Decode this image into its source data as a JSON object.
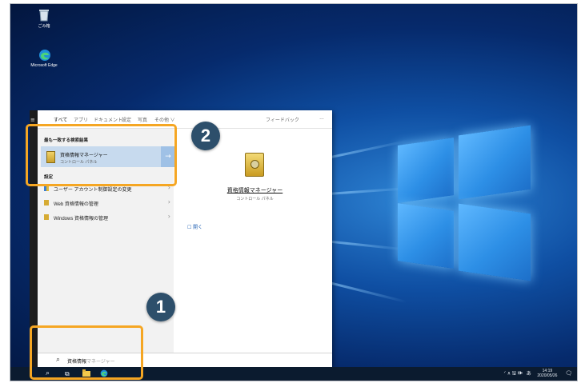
{
  "desktop": {
    "icons": [
      {
        "label": "ごみ箱",
        "icon": "recycle-bin-icon"
      },
      {
        "label": "Microsoft Edge",
        "icon": "edge-icon"
      }
    ]
  },
  "start_menu": {
    "tabs": [
      "すべて",
      "アプリ",
      "ドキュメント",
      "設定",
      "写真",
      "その他 ∨"
    ],
    "feedback": "フィードバック",
    "more": "…",
    "best_match_label": "最も一致する検索結果",
    "best_match": {
      "title": "資格情報マネージャー",
      "subtitle": "コントロール パネル",
      "arrow": "→"
    },
    "settings_label": "設定",
    "settings_items": [
      {
        "label": "ユーザー アカウント制御設定の変更",
        "icon": "flag-icon"
      },
      {
        "label": "Web 資格情報の管理",
        "icon": "credential-icon"
      },
      {
        "label": "Windows 資格情報の管理",
        "icon": "credential-icon"
      }
    ],
    "detail": {
      "title": "資格情報マネージャー",
      "subtitle": "コントロール パネル",
      "open_icon": "☐",
      "open_label": "開く"
    },
    "search": {
      "typed": "資格情報",
      "suggestion": "マネージャー"
    }
  },
  "taskbar": {
    "time": "14:19",
    "date": "2020/05/26",
    "ime": "あ",
    "tray_symbols": "ᐟ ∧ 🖫 🕪"
  },
  "annotations": [
    {
      "number": "1"
    },
    {
      "number": "2"
    }
  ],
  "colors": {
    "highlight": "#f5a623",
    "badge": "#2d4f6b",
    "selection": "#c7daee"
  }
}
